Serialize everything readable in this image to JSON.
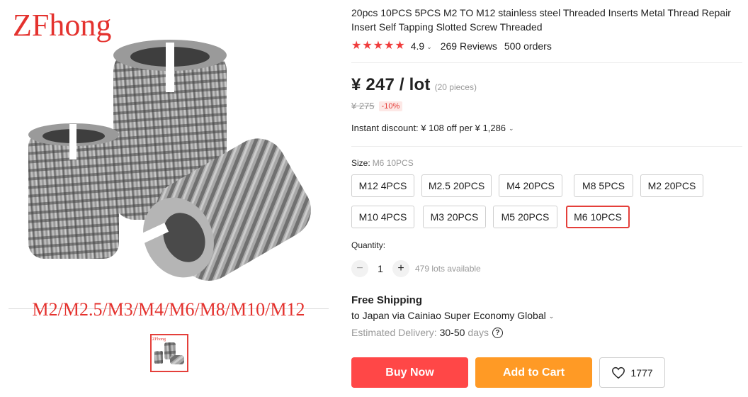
{
  "gallery": {
    "brand_text": "ZFhong",
    "sizes_text": "M2/M2.5/M3/M4/M6/M8/M10/M12",
    "thumb_brand_text": "ZFhong"
  },
  "product": {
    "title": "20pcs 10PCS 5PCS M2 TO M12 stainless steel Threaded Inserts Metal Thread Repair Insert Self Tapping Slotted Screw Threaded",
    "rating": "4.9",
    "reviews": "269 Reviews",
    "orders": "500 orders",
    "star_count": 5
  },
  "price": {
    "current": "¥ 247 / lot",
    "pieces": "(20 pieces)",
    "original": "¥ 275",
    "discount": "-10%",
    "instant_discount": "Instant discount: ¥ 108 off per ¥ 1,286"
  },
  "size": {
    "label": "Size:",
    "selected": "M6 10PCS",
    "options": [
      "M12 4PCS",
      "M2.5 20PCS",
      "M4 20PCS",
      "M8 5PCS",
      "M2 20PCS",
      "M10 4PCS",
      "M3 20PCS",
      "M5 20PCS",
      "M6 10PCS"
    ]
  },
  "quantity": {
    "label": "Quantity:",
    "value": "1",
    "minus": "−",
    "plus": "+",
    "available": "479 lots available"
  },
  "shipping": {
    "title": "Free Shipping",
    "destination": "to Japan via Cainiao Super Economy Global",
    "delivery_label": "Estimated Delivery:",
    "delivery_value": "30-50",
    "delivery_unit": "days",
    "help": "?"
  },
  "actions": {
    "buy_now": "Buy Now",
    "add_to_cart": "Add to Cart",
    "wishlist_count": "1777"
  },
  "colors": {
    "accent_red": "#ff4747",
    "cart_orange": "#ff9a25",
    "star_red": "#f03c3c",
    "brand_red": "#e4322e"
  }
}
